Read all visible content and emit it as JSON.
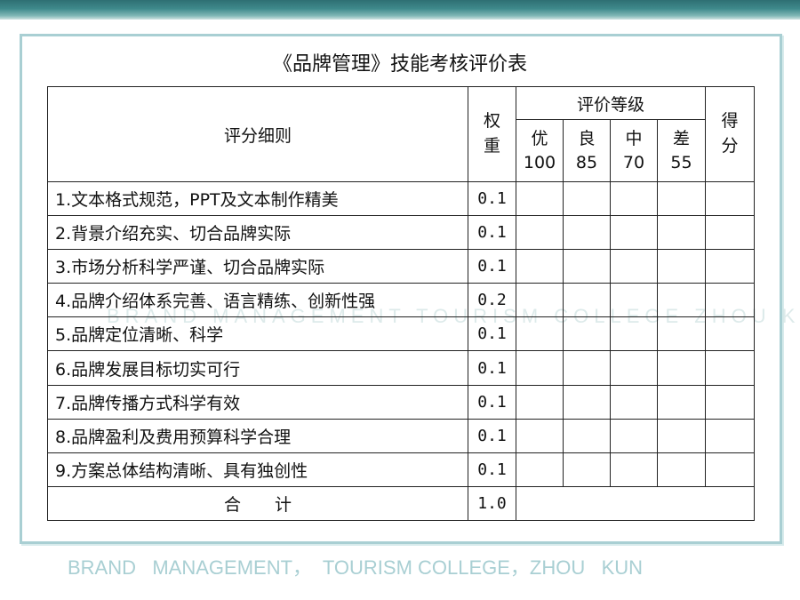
{
  "title": "《品牌管理》技能考核评价表",
  "watermark": "BRAND MANAGEMENT TOURISM COLLEGE ZHOU KUN",
  "header": {
    "criteria": "评分细则",
    "weight": "权重",
    "weight_line1": "权",
    "weight_line2": "重",
    "rating_group": "评价等级",
    "score": "得分",
    "score_line1": "得",
    "score_line2": "分",
    "grades": [
      {
        "name": "优",
        "points": "100"
      },
      {
        "name": "良",
        "points": "85"
      },
      {
        "name": "中",
        "points": "70"
      },
      {
        "name": "差",
        "points": "55"
      }
    ]
  },
  "rows": [
    {
      "criterion": "1.文本格式规范，PPT及文本制作精美",
      "weight": "0.1"
    },
    {
      "criterion": "2.背景介绍充实、切合品牌实际",
      "weight": "0.1"
    },
    {
      "criterion": "3.市场分析科学严谨、切合品牌实际",
      "weight": "0.1"
    },
    {
      "criterion": "4.品牌介绍体系完善、语言精练、创新性强",
      "weight": "0.2"
    },
    {
      "criterion": "5.品牌定位清晰、科学",
      "weight": "0.1"
    },
    {
      "criterion": "6.品牌发展目标切实可行",
      "weight": "0.1"
    },
    {
      "criterion": "7.品牌传播方式科学有效",
      "weight": "0.1"
    },
    {
      "criterion": "8.品牌盈利及费用预算科学合理",
      "weight": "0.1"
    },
    {
      "criterion": "9.方案总体结构清晰、具有独创性",
      "weight": "0.1"
    }
  ],
  "total": {
    "label": "合　　计",
    "weight": "1.0"
  },
  "footer": "BRAND   MANAGEMENT，  TOURISM COLLEGE，ZHOU   KUN",
  "colors": {
    "accent": "#a9cfd3",
    "band": "#3f8a8c"
  }
}
